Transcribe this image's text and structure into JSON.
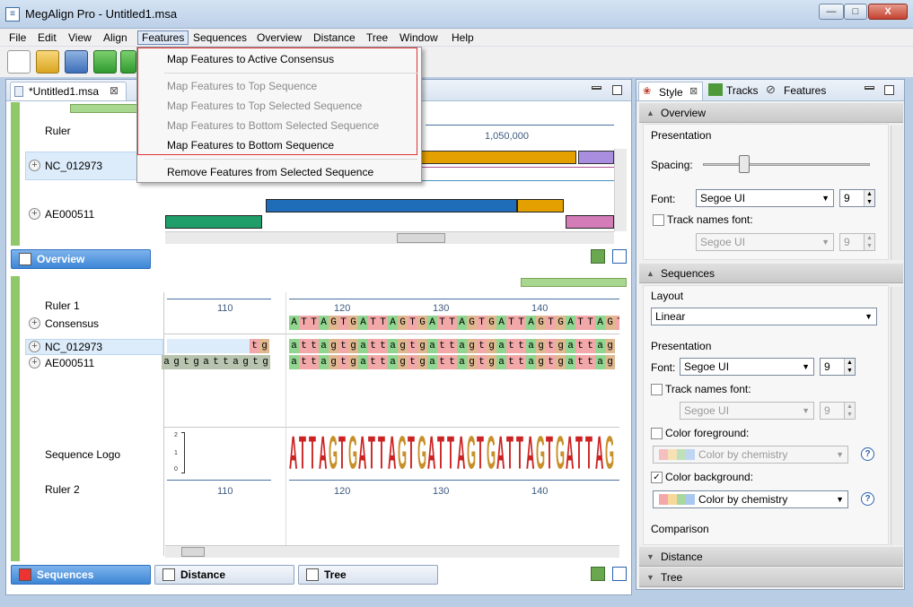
{
  "window": {
    "title": "MegAlign Pro - Untitled1.msa",
    "minimize": "—",
    "maximize": "□",
    "close": "X"
  },
  "menu": [
    "File",
    "Edit",
    "View",
    "Align",
    "Features",
    "Sequences",
    "Overview",
    "Distance",
    "Tree",
    "Window",
    "Help"
  ],
  "features_menu": {
    "items": [
      {
        "label": "Map Features to Active Consensus",
        "enabled": true
      },
      {
        "label": "Map Features to Top Sequence",
        "enabled": false
      },
      {
        "label": "Map Features to Top Selected Sequence",
        "enabled": false
      },
      {
        "label": "Map Features to Bottom Selected Sequence",
        "enabled": false
      },
      {
        "label": "Map Features to Bottom Sequence",
        "enabled": true
      },
      {
        "label": "Remove Features from Selected Sequence",
        "enabled": true
      }
    ]
  },
  "editor_tab": {
    "label": "*Untitled1.msa",
    "close": "⊠"
  },
  "overview": {
    "rows": [
      "Ruler",
      "NC_012973",
      "AE000511"
    ],
    "ruler_value": "1,050,000",
    "tab_label": "Overview"
  },
  "alignment": {
    "labels": [
      "Ruler 1",
      "Consensus",
      "NC_012973",
      "AE000511",
      "Sequence Logo",
      "Ruler 2"
    ],
    "ruler_ticks": [
      "110",
      "120",
      "130",
      "140"
    ],
    "consensus": "ATTAGTGATTAGTGATTAGTGATTAGTGATTAGT",
    "seq1_left": "tg",
    "seq2_left": "agtgattagtg",
    "seq": "attagtgattagtgattagtgattagtgattag",
    "logo": "ATTAGTGATTAGTGATTAGTGATTAGTGATTAG",
    "logo_axis": [
      "2",
      "1",
      "0"
    ]
  },
  "bottom_tabs": [
    "Sequences",
    "Distance",
    "Tree"
  ],
  "right_panel": {
    "tabs": [
      "Style",
      "Tracks",
      "Features"
    ],
    "sections": {
      "overview": "Overview",
      "sequences": "Sequences",
      "distance": "Distance",
      "tree": "Tree"
    },
    "overview": {
      "presentation": "Presentation",
      "spacing": "Spacing:",
      "font_label": "Font:",
      "font": "Segoe UI",
      "font_size": "9",
      "track_names_font": "Track names font:",
      "track_font": "Segoe UI",
      "track_font_size": "9"
    },
    "sequences": {
      "layout_label": "Layout",
      "layout": "Linear",
      "presentation": "Presentation",
      "font_label": "Font:",
      "font": "Segoe UI",
      "font_size": "9",
      "track_names_font": "Track names font:",
      "track_font": "Segoe UI",
      "track_font_size": "9",
      "color_foreground": "Color foreground:",
      "fg_value": "Color by chemistry",
      "color_background": "Color background:",
      "bg_value": "Color by chemistry",
      "comparison": "Comparison",
      "help": "?"
    }
  },
  "colors": {
    "A": "#90d690",
    "T": "#f2a8a8",
    "G": "#e0b890",
    "C": "#a8c8f0",
    "logoA": "#cc2222",
    "logoT": "#cc2222",
    "logoG": "#c8902a"
  }
}
